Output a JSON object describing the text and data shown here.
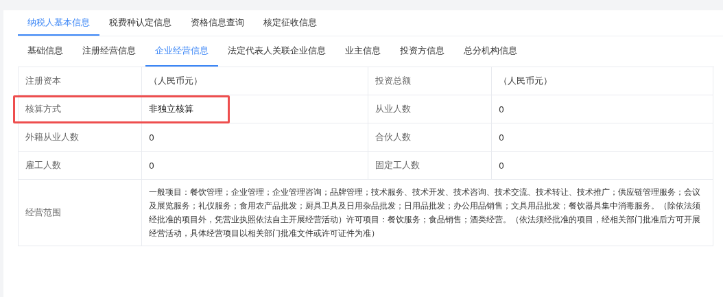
{
  "tabs": [
    {
      "label": "纳税人基本信息",
      "selected": true
    },
    {
      "label": "税费种认定信息",
      "selected": false
    },
    {
      "label": "资格信息查询",
      "selected": false
    },
    {
      "label": "核定征收信息",
      "selected": false
    }
  ],
  "subtabs": [
    {
      "label": "基础信息",
      "selected": false
    },
    {
      "label": "注册经营信息",
      "selected": false
    },
    {
      "label": "企业经营信息",
      "selected": true
    },
    {
      "label": "法定代表人关联企业信息",
      "selected": false
    },
    {
      "label": "业主信息",
      "selected": false
    },
    {
      "label": "投资方信息",
      "selected": false
    },
    {
      "label": "总分机构信息",
      "selected": false
    }
  ],
  "rows": [
    {
      "fields": [
        {
          "label": "注册资本",
          "value": "（人民币元）",
          "highlighted": false
        },
        {
          "label": "投资总额",
          "value": "（人民币元）",
          "highlighted": false
        }
      ]
    },
    {
      "fields": [
        {
          "label": "核算方式",
          "value": "非独立核算",
          "highlighted": true
        },
        {
          "label": "从业人数",
          "value": "0",
          "highlighted": false
        }
      ]
    },
    {
      "fields": [
        {
          "label": "外籍从业人数",
          "value": "0",
          "highlighted": false
        },
        {
          "label": "合伙人数",
          "value": "0",
          "highlighted": false
        }
      ]
    },
    {
      "fields": [
        {
          "label": "雇工人数",
          "value": "0",
          "highlighted": false
        },
        {
          "label": "固定工人数",
          "value": "0",
          "highlighted": false
        }
      ]
    },
    {
      "fields": [
        {
          "label": "经营范围",
          "value": "一般项目：餐饮管理；企业管理；企业管理咨询；品牌管理；技术服务、技术开发、技术咨询、技术交流、技术转让、技术推广；供应链管理服务；会议及展览服务；礼仪服务；食用农产品批发；厨具卫具及日用杂品批发；日用品批发；办公用品销售；文具用品批发；餐饮器具集中消毒服务。（除依法须经批准的项目外，凭营业执照依法自主开展经营活动）许可项目：餐饮服务；食品销售；酒类经营。（依法须经批准的项目，经相关部门批准后方可开展经营活动，具体经营项目以相关部门批准文件或许可证件为准）",
          "highlighted": false
        }
      ]
    }
  ]
}
